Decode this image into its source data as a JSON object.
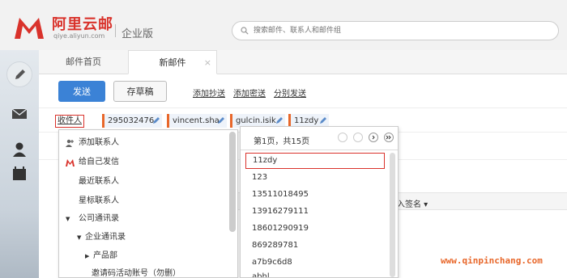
{
  "header": {
    "brand": "阿里云邮",
    "brand_url": "qiye.aliyun.com",
    "edition": "企业版",
    "search_placeholder": "搜索邮件、联系人和邮件组"
  },
  "tabs": [
    {
      "label": "邮件首页"
    },
    {
      "label": "新邮件",
      "close": "×"
    }
  ],
  "toolbar": {
    "send_label": "发送",
    "draft_label": "存草稿",
    "add_cc": "添加抄送",
    "add_bcc": "添加密送",
    "separate_send": "分别发送"
  },
  "recipients": {
    "label": "收件人",
    "chips": [
      "295032476",
      "vincent.sha",
      "gulcin.isik",
      "11zdy"
    ]
  },
  "signature": {
    "label": "入签名 ▾"
  },
  "contacts_menu": {
    "items": [
      "添加联系人",
      "给自己发信",
      "最近联系人",
      "星标联系人",
      "公司通讯录",
      "企业通讯录",
      "产品部",
      "邀请码活动账号（勿删）"
    ]
  },
  "pager": {
    "title": "第1页，共15页",
    "items": [
      "11zdy",
      "123",
      "13511018495",
      "13916279111",
      "18601290919",
      "869289781",
      "a7b9c6d8",
      "abhl"
    ]
  },
  "watermark": "www.qinpinchang.com",
  "colors": {
    "accent": "#3b82d6",
    "brand": "#d9322b",
    "chip_border": "#e8672a"
  }
}
